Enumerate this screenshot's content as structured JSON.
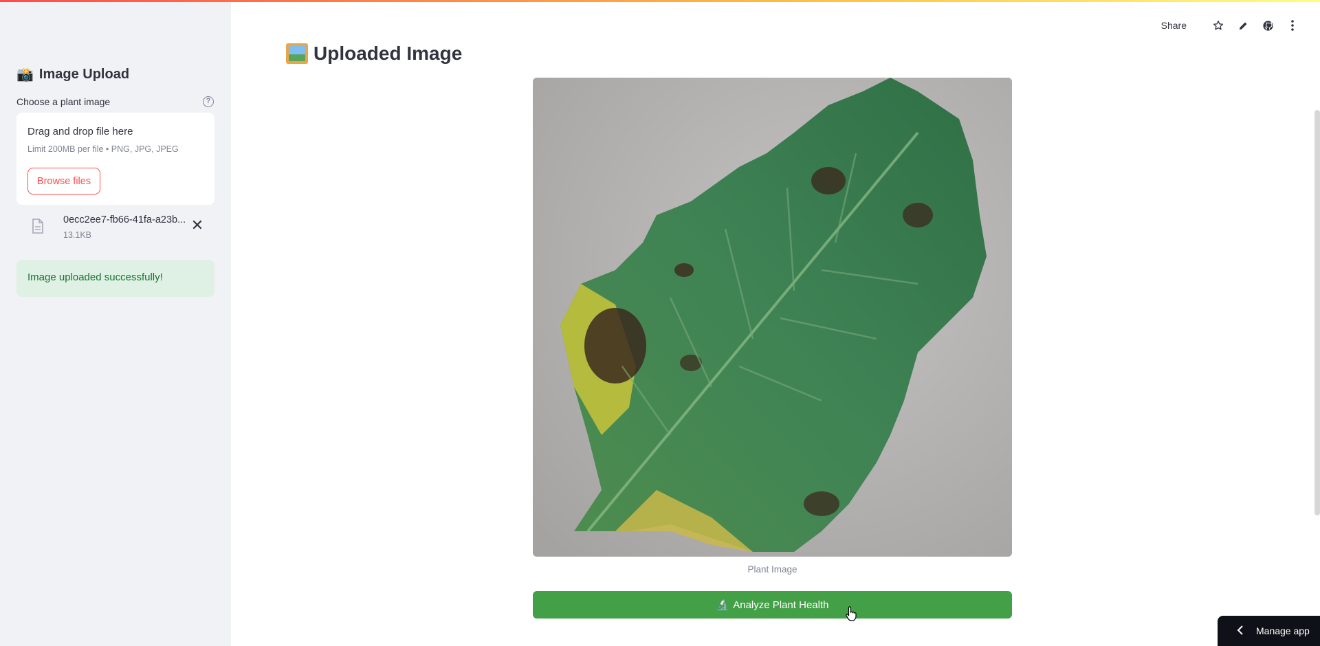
{
  "sidebar": {
    "heading_emoji": "📸",
    "heading": "Image Upload",
    "uploader_label": "Choose a plant image",
    "dropzone": {
      "title": "Drag and drop file here",
      "limit": "Limit 200MB per file • PNG, JPG, JPEG",
      "browse_label": "Browse files"
    },
    "file": {
      "name": "0ecc2ee7-fb66-41fa-a23b...",
      "size": "13.1KB"
    },
    "success_message": "Image uploaded successfully!"
  },
  "header": {
    "share_label": "Share",
    "icons": [
      "star-icon",
      "pencil-icon",
      "github-icon",
      "more-vertical-icon"
    ]
  },
  "main": {
    "title": "Uploaded Image",
    "image_caption": "Plant Image",
    "analyze_emoji": "🔬",
    "analyze_label": "Analyze Plant Health"
  },
  "footer": {
    "manage_app_label": "Manage app"
  },
  "colors": {
    "accent": "#ff4b4b",
    "success_bg": "#dff0e4",
    "success_text": "#177233",
    "button_green": "#43a047",
    "sidebar_bg": "#f0f2f6"
  }
}
